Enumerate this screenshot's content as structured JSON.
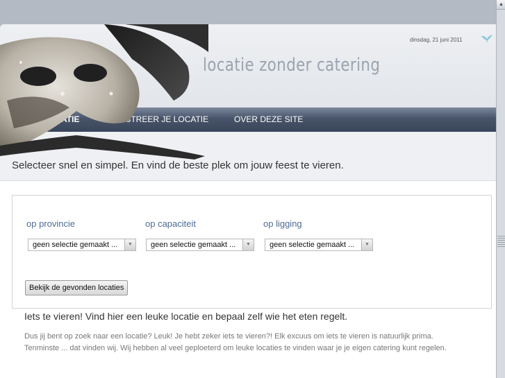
{
  "header": {
    "date": "dinsdag, 21 juni 2011",
    "site_title": "locatie zonder catering"
  },
  "nav": {
    "items": [
      {
        "label": "ZOEK LOCATIE"
      },
      {
        "label": "REGISTREER JE LOCATIE"
      },
      {
        "label": "OVER DEZE SITE"
      }
    ]
  },
  "tagline": "Selecteer snel en simpel. En vind de beste plek om jouw feest te vieren.",
  "search": {
    "filters": [
      {
        "label": "op provincie",
        "selected": "geen selectie gemaakt ..."
      },
      {
        "label": "op capaciteit",
        "selected": "geen selectie gemaakt ..."
      },
      {
        "label": "op ligging",
        "selected": "geen selectie gemaakt ..."
      }
    ],
    "submit_label": "Bekijk de gevonden locaties"
  },
  "intro": {
    "title": "Iets te vieren! Vind hier een leuke locatie en bepaal zelf wie het eten regelt.",
    "line1": "Dus jij bent op zoek naar een locatie? Leuk! Je hebt zeker iets te vieren?! Elk excuus om iets te vieren is natuurlijk prima.",
    "line2": "Tenminste ... dat vinden wij. Wij hebben al veel geploeterd om leuke locaties te vinden waar je je eigen catering kunt regelen."
  },
  "icons": {
    "bird": "bird-logo-icon",
    "mask": "masquerade-mask-image",
    "select_arrow": "dropdown-arrow-icon",
    "scroll_up": "scroll-up-arrow-icon"
  },
  "colors": {
    "nav_bg": "#48546a",
    "label_blue": "#4f6b95",
    "title_grey": "#9aa3af"
  }
}
